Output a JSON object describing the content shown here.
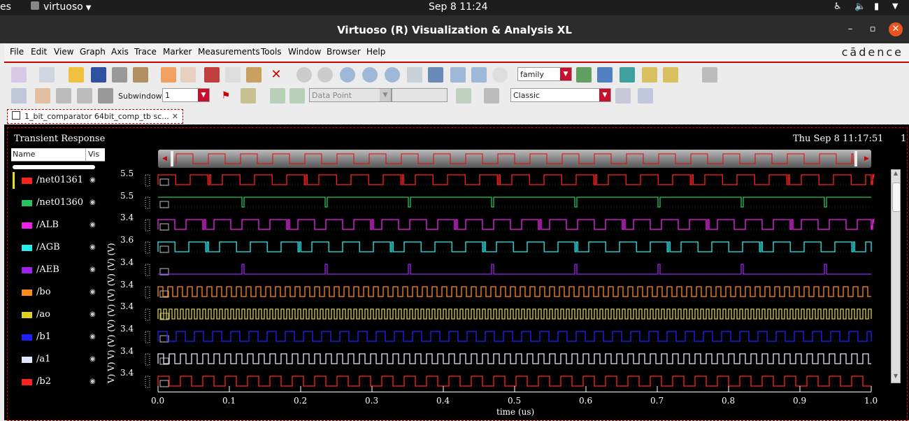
{
  "topbar": {
    "activities": "es",
    "app": "virtuoso",
    "clock": "Sep 8  11:24"
  },
  "window": {
    "title": "Virtuoso (R) Visualization & Analysis XL",
    "minimize": "–",
    "maximize": "▫",
    "close": "✕"
  },
  "menu": {
    "items": [
      "File",
      "Edit",
      "View",
      "Graph",
      "Axis",
      "Trace",
      "Marker",
      "Measurements",
      "Tools",
      "Window",
      "Browser",
      "Help"
    ],
    "brand": "cādence"
  },
  "toolbar1": {
    "family_select": "family"
  },
  "toolbar2": {
    "subwindow_label": "Subwindow:",
    "subwindow_value": "1",
    "data_point_placeholder": "Data Point",
    "style_select": "Classic"
  },
  "tab": {
    "label": "1_bit_comparator 64bit_comp_tb sc..."
  },
  "graph": {
    "title": "Transient Response",
    "datetime": "Thu Sep 8 11:17:51",
    "corner_marker": "1",
    "legend_headers": {
      "name": "Name",
      "vis": "Vis"
    },
    "signals": [
      {
        "name": "/net01361",
        "color": "#ff2020",
        "ytick": "5.5"
      },
      {
        "name": "/net01360",
        "color": "#22c55e",
        "ytick": "5.5"
      },
      {
        "name": "/ALB",
        "color": "#ee22ee",
        "ytick": "3.4"
      },
      {
        "name": "/AGB",
        "color": "#22eeee",
        "ytick": "3.6"
      },
      {
        "name": "/AEB",
        "color": "#a020f0",
        "ytick": "3.4"
      },
      {
        "name": "/bo",
        "color": "#ff8c1a",
        "ytick": "3.4"
      },
      {
        "name": "/ao",
        "color": "#ddd020",
        "ytick": "3.4"
      },
      {
        "name": "/b1",
        "color": "#2020ff",
        "ytick": "3.4"
      },
      {
        "name": "/a1",
        "color": "#dde6ff",
        "ytick": "3.4"
      },
      {
        "name": "/b2",
        "color": "#ff2020",
        "ytick": "3.4"
      }
    ],
    "y_axis_label": "V) V) V) (V) (V) (V) (V) (V) (V) (V)",
    "x_axis": {
      "label": "time (us)",
      "ticks": [
        "0.0",
        "0.1",
        "0.2",
        "0.3",
        "0.4",
        "0.5",
        "0.6",
        "0.7",
        "0.8",
        "0.9",
        "1.0"
      ]
    }
  }
}
